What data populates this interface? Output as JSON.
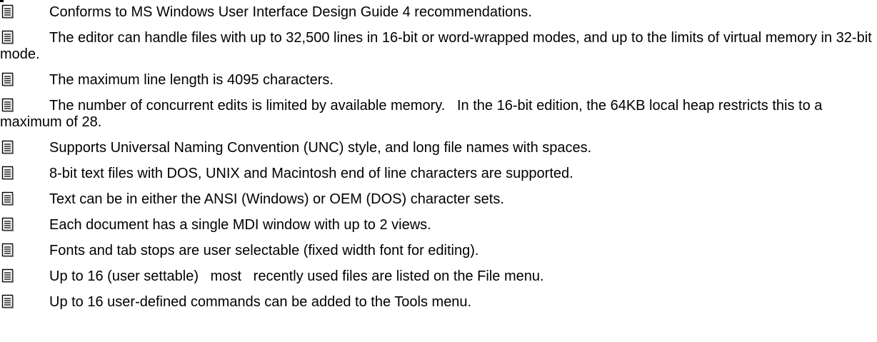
{
  "features": [
    {
      "icon": "document-icon",
      "text": "Conforms to MS Windows User Interface Design Guide 4 recommendations."
    },
    {
      "icon": "document-icon",
      "text": "The editor can handle files with up to 32,500 lines in 16-bit or word-wrapped modes, and up to the limits of virtual memory in 32-bit mode."
    },
    {
      "icon": "document-icon",
      "text": "The maximum line length is 4095 characters."
    },
    {
      "icon": "document-icon",
      "text": "The number of concurrent edits is limited by available memory.   In the 16-bit edition, the 64KB local heap restricts this to a maximum of 28."
    },
    {
      "icon": "document-icon",
      "text": "Supports Universal Naming Convention (UNC) style, and long file names with spaces."
    },
    {
      "icon": "document-icon",
      "text": "8-bit text files with DOS, UNIX and Macintosh end of line characters are supported."
    },
    {
      "icon": "document-icon",
      "text": "Text can be in either the ANSI (Windows) or OEM (DOS) character sets."
    },
    {
      "icon": "document-icon",
      "text": "Each document has a single MDI window with up to 2 views."
    },
    {
      "icon": "document-icon",
      "text": "Fonts and tab stops are user selectable (fixed width font for editing)."
    },
    {
      "icon": "document-icon",
      "text": "Up to 16 (user settable)   most   recently used files are listed on the File menu."
    },
    {
      "icon": "document-icon",
      "text": "Up to 16 user-defined commands can be added to the Tools menu."
    }
  ]
}
